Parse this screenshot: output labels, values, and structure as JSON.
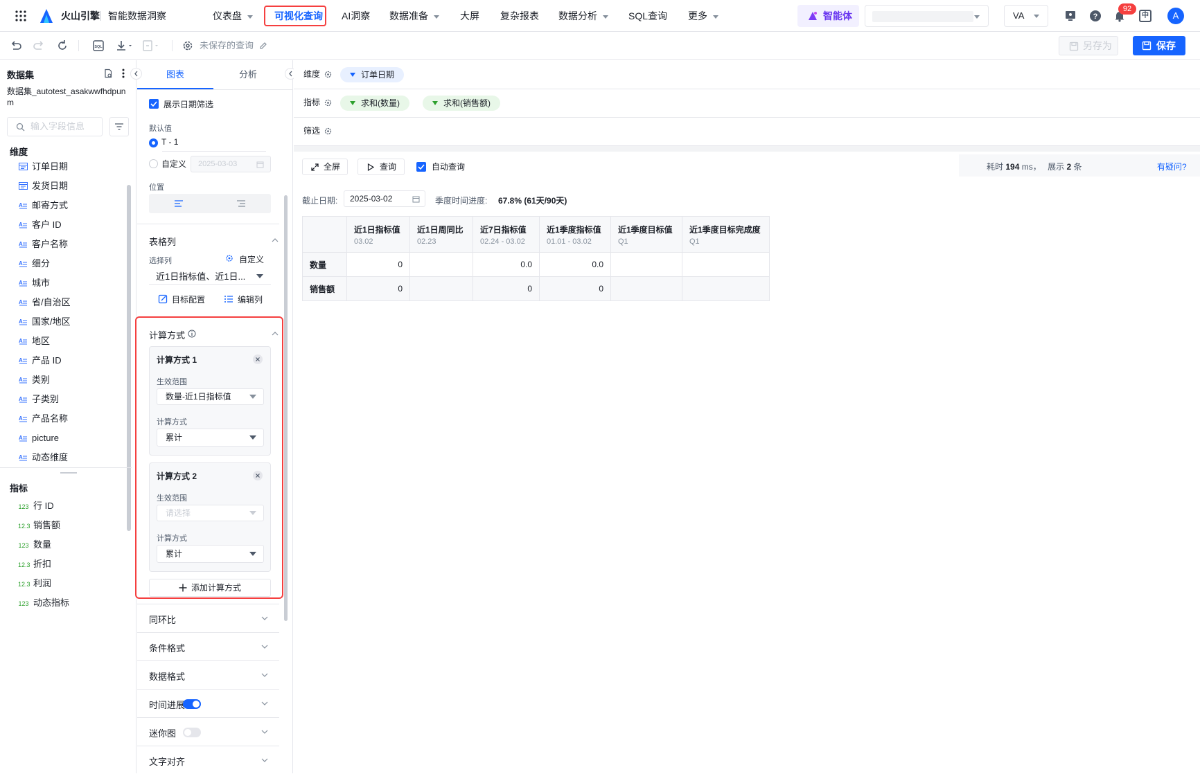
{
  "nav": {
    "app_name": "火山引擎",
    "product_name": "智能数据洞察",
    "items": [
      {
        "label": "仪表盘",
        "caret": true
      },
      {
        "label": "可视化查询",
        "caret": false,
        "active": true
      },
      {
        "label": "AI洞察",
        "caret": false
      },
      {
        "label": "数据准备",
        "caret": true
      },
      {
        "label": "大屏",
        "caret": false
      },
      {
        "label": "复杂报表",
        "caret": false
      },
      {
        "label": "数据分析",
        "caret": true
      },
      {
        "label": "SQL查询",
        "caret": false
      },
      {
        "label": "更多",
        "caret": true
      }
    ],
    "agent_label": "智能体",
    "workspace_select": "VA",
    "notification_count": "92",
    "lang_label": "中",
    "avatar_letter": "A"
  },
  "toolbar": {
    "query_name": "未保存的查询",
    "save_as_label": "另存为",
    "save_label": "保存"
  },
  "dataset": {
    "title": "数据集",
    "name": "数据集_autotest_asakwwfhdpunm",
    "search_placeholder": "输入字段信息",
    "dimensions_title": "维度",
    "dimensions": [
      {
        "icon": "date",
        "label": "订单日期"
      },
      {
        "icon": "date",
        "label": "发货日期"
      },
      {
        "icon": "text",
        "label": "邮寄方式"
      },
      {
        "icon": "text",
        "label": "客户 ID"
      },
      {
        "icon": "text",
        "label": "客户名称"
      },
      {
        "icon": "text",
        "label": "细分"
      },
      {
        "icon": "text",
        "label": "城市"
      },
      {
        "icon": "text",
        "label": "省/自治区"
      },
      {
        "icon": "text",
        "label": "国家/地区"
      },
      {
        "icon": "text",
        "label": "地区"
      },
      {
        "icon": "text",
        "label": "产品 ID"
      },
      {
        "icon": "text",
        "label": "类别"
      },
      {
        "icon": "text",
        "label": "子类别"
      },
      {
        "icon": "text",
        "label": "产品名称"
      },
      {
        "icon": "text",
        "label": "picture"
      },
      {
        "icon": "text",
        "label": "动态维度"
      }
    ],
    "metrics_title": "指标",
    "metrics": [
      {
        "icon": "123",
        "label": "行 ID"
      },
      {
        "icon": "12.3",
        "label": "销售额"
      },
      {
        "icon": "123",
        "label": "数量"
      },
      {
        "icon": "12.3",
        "label": "折扣"
      },
      {
        "icon": "12.3",
        "label": "利润"
      },
      {
        "icon": "123",
        "label": "动态指标"
      }
    ]
  },
  "config": {
    "tab_chart": "图表",
    "tab_analysis": "分析",
    "show_date_filter_label": "展示日期筛选",
    "default_value_label": "默认值",
    "radio_t1": "T - 1",
    "radio_custom": "自定义",
    "custom_date_placeholder": "2025-03-03",
    "position_label": "位置",
    "table_columns_title": "表格列",
    "select_columns_label": "选择列",
    "custom_label": "自定义",
    "columns_value": "近1日指标值、近1日...",
    "target_config_label": "目标配置",
    "edit_columns_label": "编辑列",
    "calc_title": "计算方式",
    "calc_items": [
      {
        "title": "计算方式 1",
        "scope_label": "生效范围",
        "scope_value": "数量-近1日指标值",
        "method_label": "计算方式",
        "method_value": "累计"
      },
      {
        "title": "计算方式 2",
        "scope_label": "生效范围",
        "scope_value": "请选择",
        "method_label": "计算方式",
        "method_value": "累计"
      }
    ],
    "add_calc_label": "添加计算方式",
    "collapsed_sections": [
      {
        "label": "同环比",
        "toggle": null
      },
      {
        "label": "条件格式",
        "toggle": null
      },
      {
        "label": "数据格式",
        "toggle": null
      },
      {
        "label": "时间进展",
        "toggle": true
      },
      {
        "label": "迷你图",
        "toggle": false
      },
      {
        "label": "文字对齐",
        "toggle": null
      }
    ]
  },
  "main": {
    "dimension_label": "维度",
    "dimension_pills": [
      "订单日期"
    ],
    "metric_label": "指标",
    "metric_pills": [
      "求和(数量)",
      "求和(销售额)"
    ],
    "filter_label": "筛选",
    "fullscreen_label": "全屏",
    "query_label": "查询",
    "auto_query_label": "自动查询",
    "time_prefix": "耗时",
    "time_value": "194",
    "time_unit": "ms，",
    "rows_prefix": "展示",
    "rows_value": "2",
    "rows_unit": "条",
    "help_link": "有疑问?",
    "cutoff_label": "截止日期:",
    "cutoff_date": "2025-03-02",
    "quarter_progress_label": "季度时间进度:",
    "quarter_progress_value": "67.8% (61天/90天)",
    "table": {
      "columns": [
        {
          "title": "近1日指标值",
          "sub": "03.02"
        },
        {
          "title": "近1日周同比",
          "sub": "02.23"
        },
        {
          "title": "近7日指标值",
          "sub": "02.24 - 03.02"
        },
        {
          "title": "近1季度指标值",
          "sub": "01.01 - 03.02"
        },
        {
          "title": "近1季度目标值",
          "sub": "Q1"
        },
        {
          "title": "近1季度目标完成度",
          "sub": "Q1"
        }
      ],
      "rows": [
        {
          "label": "数量",
          "cells": [
            "0",
            "",
            "0.0",
            "0.0",
            "",
            ""
          ]
        },
        {
          "label": "销售额",
          "cells": [
            "0",
            "",
            "0",
            "0",
            "",
            ""
          ]
        }
      ]
    }
  },
  "colors": {
    "accent": "#1664ff",
    "highlight": "#f53f3f",
    "metric_pill_bg": "#e8f7e8",
    "dim_pill_bg": "#e8f0ff"
  }
}
